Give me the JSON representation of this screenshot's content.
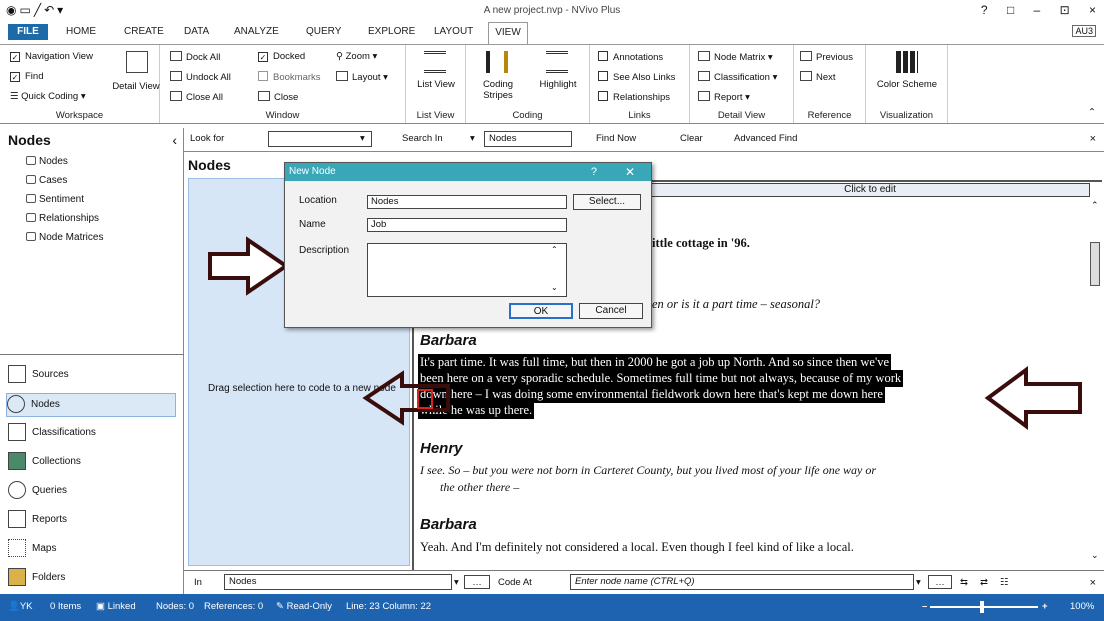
{
  "app": {
    "window_title": "A new project.nvp - NVivo Plus",
    "window_controls": [
      "?",
      "□",
      "–",
      "⊡",
      "×"
    ],
    "signin": "AU3"
  },
  "tabs": [
    "FILE",
    "HOME",
    "CREATE",
    "DATA",
    "ANALYZE",
    "QUERY",
    "EXPLORE",
    "LAYOUT",
    "VIEW"
  ],
  "ribbon": {
    "workspace": {
      "label": "Workspace",
      "navigation_view": "Navigation View",
      "find": "Find",
      "quick_coding": "Quick Coding",
      "detail_view": "Detail View"
    },
    "window": {
      "label": "Window",
      "dock_all": "Dock All",
      "undock_all": "Undock All",
      "close_all": "Close All",
      "docked": "Docked",
      "bookmarks": "Bookmarks",
      "close": "Close",
      "zoom": "Zoom",
      "layout": "Layout"
    },
    "list_view": {
      "label": "List View",
      "button": "List View"
    },
    "coding": {
      "label": "Coding",
      "coding_stripes": "Coding Stripes",
      "highlight": "Highlight"
    },
    "links": {
      "label": "Links",
      "annotations": "Annotations",
      "see_also_links": "See Also Links",
      "relationships": "Relationships"
    },
    "detail_view": {
      "label": "Detail View",
      "node_matrix": "Node Matrix",
      "classification": "Classification",
      "report": "Report"
    },
    "reference": {
      "label": "Reference",
      "previous": "Previous",
      "next": "Next"
    },
    "visualization": {
      "label": "Visualization",
      "color_scheme": "Color Scheme"
    }
  },
  "search": {
    "look_for_label": "Look for",
    "look_for_value": "",
    "search_in_label": "Search In",
    "search_in_value": "Nodes",
    "find_now": "Find Now",
    "clear": "Clear",
    "advanced_find": "Advanced Find"
  },
  "left_panel": {
    "title": "Nodes",
    "tree": [
      "Nodes",
      "Cases",
      "Sentiment",
      "Relationships",
      "Node Matrices"
    ],
    "nav": [
      "Sources",
      "Nodes",
      "Classifications",
      "Collections",
      "Queries",
      "Reports",
      "Maps",
      "Folders"
    ]
  },
  "list_pane": {
    "title": "Nodes",
    "drag_hint": "Drag selection here to code to a new node"
  },
  "dialog": {
    "title": "New Node",
    "location_label": "Location",
    "location_value": "Nodes",
    "select_button": "Select...",
    "name_label": "Name",
    "name_value": "Job",
    "description_label": "Description",
    "description_value": "",
    "ok": "OK",
    "cancel": "Cancel"
  },
  "document": {
    "click_to_edit": "Click to edit",
    "line_cottage": "ittle cottage in '96.",
    "line_question": "en or is it a part time – seasonal?",
    "speaker_1": "Barbara",
    "highlighted_lines": [
      "It's part time. It was full time, but then in 2000 he got a job up North. And so since then we've",
      "been here on a very sporadic schedule. Sometimes full time but not always, because of my work",
      "down here – I was doing some environmental fieldwork down here that's kept me down here",
      "while he was up there."
    ],
    "speaker_2": "Henry",
    "henry_line_1": "I see. So – but you were not born in Carteret County, but you lived most of your life one way or",
    "henry_line_2": "the other there –",
    "speaker_3": "Barbara",
    "barbara_line": "Yeah. And I'm definitely not considered a local. Even though I feel kind of like a local."
  },
  "code_bar": {
    "in_label": "In",
    "in_value": "Nodes",
    "code_at_label": "Code At",
    "code_at_placeholder": "Enter node name (CTRL+Q)"
  },
  "status": {
    "user": "YK",
    "items": "0 Items",
    "linked": "Linked",
    "nodes": "Nodes: 0",
    "references": "References: 0",
    "read_only": "Read-Only",
    "position": "Line: 23 Column: 22",
    "zoom": "100%"
  },
  "colors": {
    "accent": "#1e63b0",
    "dialog_title": "#3aa7b8",
    "list_pane_bg": "#d6e6f7",
    "arrow_outline": "#4a1010"
  }
}
